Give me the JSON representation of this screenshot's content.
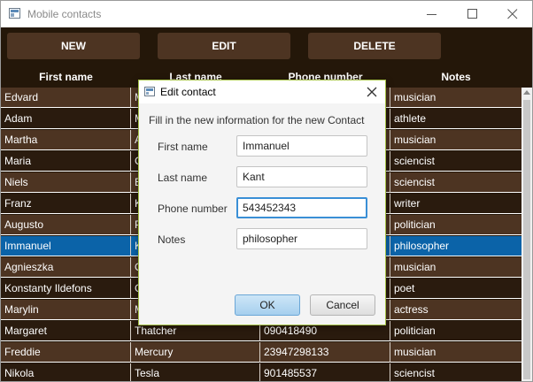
{
  "window": {
    "title": "Mobile contacts"
  },
  "toolbar": {
    "new_label": "NEW",
    "edit_label": "EDIT",
    "delete_label": "DELETE"
  },
  "table": {
    "columns": [
      "First name",
      "Last name",
      "Phone number",
      "Notes"
    ],
    "rows": [
      [
        "Edvard",
        "Munch",
        "",
        "musician"
      ],
      [
        "Adam",
        "Malysz",
        "",
        "athlete"
      ],
      [
        "Martha",
        "Argerich",
        "",
        "musician"
      ],
      [
        "Maria",
        "Curie",
        "",
        "sciencist"
      ],
      [
        "Niels",
        "Bohr",
        "",
        "sciencist"
      ],
      [
        "Franz",
        "Kafka",
        "",
        "writer"
      ],
      [
        "Augusto",
        "Pinochet",
        "",
        "politician"
      ],
      [
        "Immanuel",
        "Kant",
        "",
        "philosopher"
      ],
      [
        "Agnieszka",
        "Osiecka",
        "",
        "musician"
      ],
      [
        "Konstanty Ildefons",
        "Galczynski",
        "",
        "poet"
      ],
      [
        "Marylin",
        "Monroe",
        "",
        "actress"
      ],
      [
        "Margaret",
        "Thatcher",
        "090418490",
        "politician"
      ],
      [
        "Freddie",
        "Mercury",
        "23947298133",
        "musician"
      ],
      [
        "Nikola",
        "Tesla",
        "901485537",
        "sciencist"
      ]
    ],
    "selected_row": 7
  },
  "dialog": {
    "title": "Edit contact",
    "header": "Fill in the new information for the new Contact",
    "fields": {
      "first_name_label": "First name",
      "first_name_value": "Immanuel",
      "last_name_label": "Last name",
      "last_name_value": "Kant",
      "phone_label": "Phone number",
      "phone_value": "543452343",
      "notes_label": "Notes",
      "notes_value": "philosopher"
    },
    "ok_label": "OK",
    "cancel_label": "Cancel"
  },
  "colors": {
    "background": "#241709",
    "row_light": "#4d3422",
    "row_dark": "#2a1b0e",
    "selection": "#0b63a8"
  }
}
